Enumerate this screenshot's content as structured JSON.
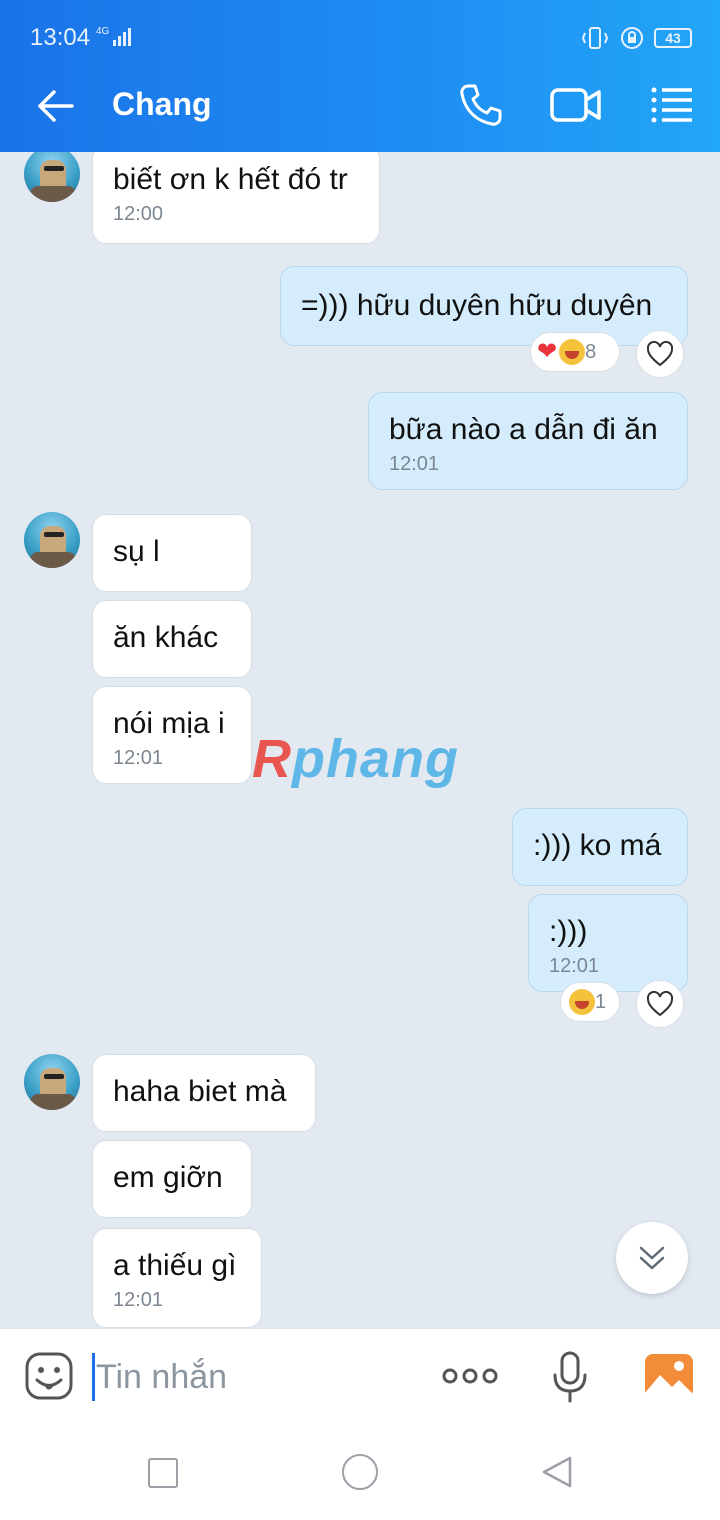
{
  "status": {
    "time": "13:04",
    "network": "4G",
    "battery": "43"
  },
  "header": {
    "title": "Chang"
  },
  "messages": {
    "m1": {
      "text": "biết ơn k hết đó tr",
      "time": "12:00"
    },
    "m2": {
      "text": "=))) hữu duyên hữu duyên",
      "reaction_count": "8"
    },
    "m3": {
      "text": "bữa nào a dẫn đi ăn",
      "time": "12:01"
    },
    "m4": {
      "text": "sụ l"
    },
    "m5": {
      "text": "ăn khác"
    },
    "m6": {
      "text": "nói mịa i",
      "time": "12:01"
    },
    "m7": {
      "text": ":))) ko má"
    },
    "m8": {
      "text": ":)))",
      "time": "12:01",
      "reaction_count": "1"
    },
    "m9": {
      "text": "haha biet mà"
    },
    "m10": {
      "text": "em giỡn"
    },
    "m11": {
      "text": "a thiếu gì",
      "time": "12:01"
    }
  },
  "watermark": {
    "r": "R",
    "rest": "phang"
  },
  "input": {
    "placeholder": "Tin nhắn"
  },
  "colors": {
    "header_start": "#1a73e8",
    "header_end": "#22a6f7",
    "outgoing_bubble": "#d4ecfb",
    "chat_bg": "#e2e9f1"
  }
}
